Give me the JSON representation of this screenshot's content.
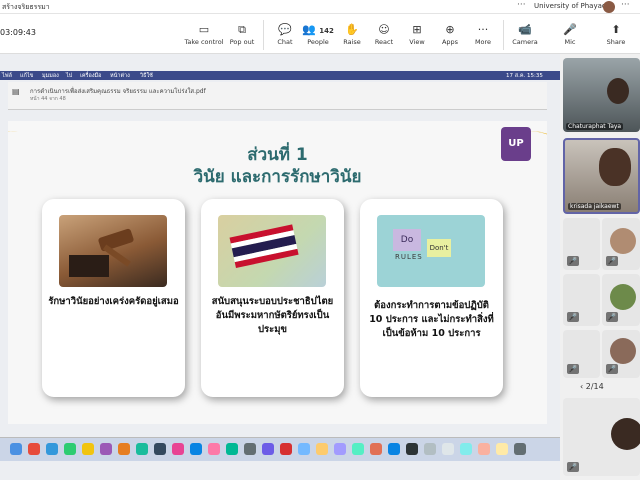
{
  "window": {
    "title": "สร้างจริยธรรมา",
    "org": "University of Phayao",
    "more": "···"
  },
  "toolbar": {
    "timer": "03:09:43",
    "items": [
      {
        "icon": "▭",
        "label": "Take control"
      },
      {
        "icon": "⧉",
        "label": "Pop out"
      },
      {
        "icon": "💬",
        "label": "Chat"
      },
      {
        "icon": "👥",
        "label": "People",
        "count": "142"
      },
      {
        "icon": "✋",
        "label": "Raise"
      },
      {
        "icon": "☺",
        "label": "React"
      },
      {
        "icon": "⊞",
        "label": "View"
      },
      {
        "icon": "⊕",
        "label": "Apps"
      },
      {
        "icon": "···",
        "label": "More"
      },
      {
        "icon": "📹",
        "label": "Camera"
      },
      {
        "icon": "🎤",
        "label": "Mic"
      },
      {
        "icon": "⬆",
        "label": "Share"
      }
    ]
  },
  "macbar": {
    "items": [
      "ไฟล์",
      "แก้ไข",
      "มุมมอง",
      "ไป",
      "เครื่องมือ",
      "หน้าต่าง",
      "วิธีใช้"
    ],
    "clock": "17 ส.ค. 15:35"
  },
  "pdf": {
    "filename": "การดำเนินการเพื่อส่งเสริมคุณธรรม จริยธรรม และความโปร่งใส.pdf",
    "pages": "หน้า 44 จาก 48"
  },
  "slide": {
    "heading1": "ส่วนที่ 1",
    "heading2": "วินัย และการรักษาวินัย",
    "logo": "UP",
    "cards": [
      {
        "text": "รักษาวินัยอย่างเคร่งครัดอยู่เสมอ"
      },
      {
        "text": "สนับสนุนระบอบประชาธิปไตยอันมีพระมหากษัตริย์ทรงเป็นประมุข"
      },
      {
        "text": "ต้องกระทำการตามข้อปฏิบัติ 10 ประการ และไม่กระทำสิ่งที่เป็นข้อห้าม 10 ประการ",
        "img_words": [
          "Do",
          "RULES",
          "Don't"
        ]
      }
    ]
  },
  "participants": [
    {
      "name": "Chaturaphat Taya",
      "video": true
    },
    {
      "name": "krisada jaikaewt",
      "video": true
    },
    {
      "name": "",
      "video": false
    },
    {
      "name": "",
      "video": false
    },
    {
      "name": "",
      "video": false
    },
    {
      "name": "",
      "video": false
    },
    {
      "name": "",
      "video": false
    }
  ],
  "pager": {
    "text": "2/14"
  },
  "colors": {
    "teal": "#2d6b6f",
    "gold": "#e9b21a",
    "purple": "#6a3e8b",
    "macbar": "#3b4a8a"
  }
}
